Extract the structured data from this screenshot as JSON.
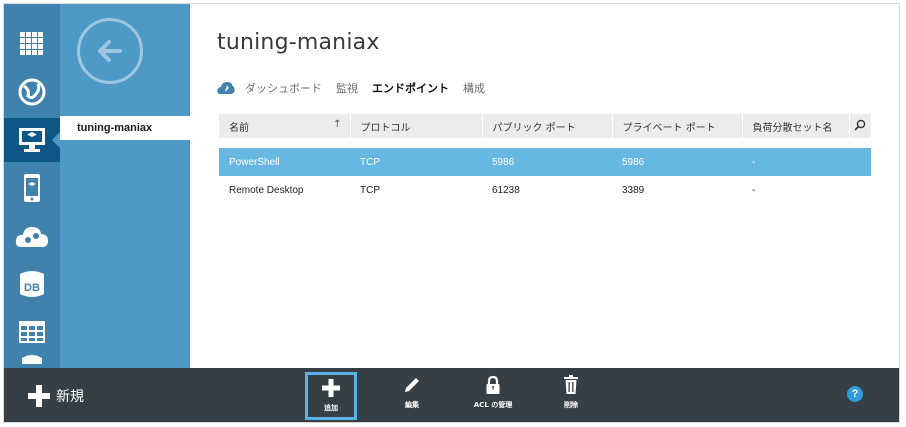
{
  "service_name": "tuning-maniax",
  "sidebar": {
    "items": [
      {
        "icon": "all-items-grid-icon"
      },
      {
        "icon": "web-sites-icon"
      },
      {
        "icon": "virtual-machines-icon",
        "active": true
      },
      {
        "icon": "mobile-services-icon"
      },
      {
        "icon": "cloud-services-icon"
      },
      {
        "icon": "sql-databases-icon",
        "label": "DB"
      },
      {
        "icon": "storage-table-icon"
      },
      {
        "icon": "storage-icon"
      }
    ],
    "selected_item": "tuning-maniax"
  },
  "tabs": [
    {
      "label": "ダッシュボード"
    },
    {
      "label": "監視"
    },
    {
      "label": "エンドポイント",
      "active": true
    },
    {
      "label": "構成"
    }
  ],
  "table": {
    "columns": [
      "名前",
      "プロトコル",
      "パブリック ポート",
      "プライベート ポート",
      "負荷分散セット名"
    ],
    "rows": [
      {
        "name": "PowerShell",
        "protocol": "TCP",
        "public_port": "5986",
        "private_port": "5986",
        "lb_set": "-",
        "selected": true
      },
      {
        "name": "Remote Desktop",
        "protocol": "TCP",
        "public_port": "61238",
        "private_port": "3389",
        "lb_set": "-",
        "selected": false
      }
    ]
  },
  "bottombar": {
    "new_label": "新規",
    "commands": [
      {
        "label": "追加",
        "icon": "plus-icon"
      },
      {
        "label": "編集",
        "icon": "pencil-icon"
      },
      {
        "label": "ACL の管理",
        "icon": "lock-icon"
      },
      {
        "label": "削除",
        "icon": "trash-icon"
      }
    ],
    "help_label": "?"
  },
  "colors": {
    "rail": "#3e82ad",
    "rail_active": "#0c5785",
    "subnav": "#4d9ac7",
    "selected_row": "#66b7e1",
    "bottombar": "#363f46",
    "highlight": "#5ab3e6"
  }
}
